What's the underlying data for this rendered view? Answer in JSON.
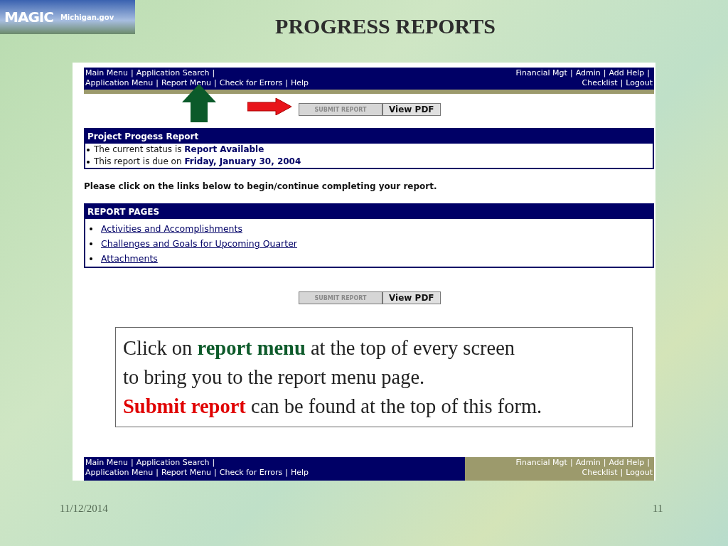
{
  "slide": {
    "title": "PROGRESS REPORTS",
    "logo": {
      "brand": "MAGIC",
      "site": "Michigan.gov"
    },
    "date": "11/12/2014",
    "page_number": "11"
  },
  "top_nav": {
    "separator": "|",
    "right_highlighted": false,
    "left_lines": [
      {
        "links": [
          "Main Menu",
          "Application Search"
        ],
        "trailing_separator": true
      },
      {
        "links": [
          "Application Menu",
          "Report Menu",
          "Check for Errors",
          "Help"
        ],
        "trailing_separator": false
      }
    ],
    "right_lines": [
      {
        "links": [
          "Financial Mgt",
          "Admin",
          "Add Help"
        ],
        "trailing_separator": true
      },
      {
        "links": [
          "Checklist",
          "Logout"
        ],
        "trailing_separator": false
      }
    ]
  },
  "top_buttons": [
    {
      "label": "SUBMIT REPORT",
      "disabled": true
    },
    {
      "label": "View PDF",
      "disabled": false
    }
  ],
  "status_panel": {
    "title": "Project Progess Report",
    "items": [
      {
        "text": "The current status is ",
        "value": "Report Available"
      },
      {
        "text": "This report is due on ",
        "value": "Friday, January 30, 2004"
      }
    ]
  },
  "instructions": "Please click on the links below to begin/continue completing your report.",
  "report_pages": {
    "title": "REPORT PAGES",
    "links": [
      "Activities and Accomplishments",
      "Challenges and Goals for Upcoming Quarter",
      "Attachments"
    ]
  },
  "bottom_buttons": [
    {
      "label": "SUBMIT REPORT",
      "disabled": true
    },
    {
      "label": "View PDF",
      "disabled": false
    }
  ],
  "callout": {
    "lines": [
      [
        {
          "text": "Click on ",
          "kind": "plain"
        },
        {
          "text": "report menu",
          "kind": "green"
        },
        {
          "text": " at the top of every screen",
          "kind": "plain"
        }
      ],
      [
        {
          "text": "to bring you to the report menu page.",
          "kind": "plain"
        }
      ],
      [
        {
          "text": "Submit report",
          "kind": "red"
        },
        {
          "text": " can be found at the top of this form.",
          "kind": "plain"
        }
      ]
    ]
  },
  "bottom_nav": {
    "separator": "|",
    "right_highlighted": true,
    "left_lines": [
      {
        "links": [
          "Main Menu",
          "Application Search"
        ],
        "trailing_separator": true
      },
      {
        "links": [
          "Application Menu",
          "Report Menu",
          "Check for Errors",
          "Help"
        ],
        "trailing_separator": false
      }
    ],
    "right_lines": [
      {
        "links": [
          "Financial Mgt",
          "Admin",
          "Add Help"
        ],
        "trailing_separator": true
      },
      {
        "links": [
          "Checklist",
          "Logout"
        ],
        "trailing_separator": false
      }
    ]
  }
}
